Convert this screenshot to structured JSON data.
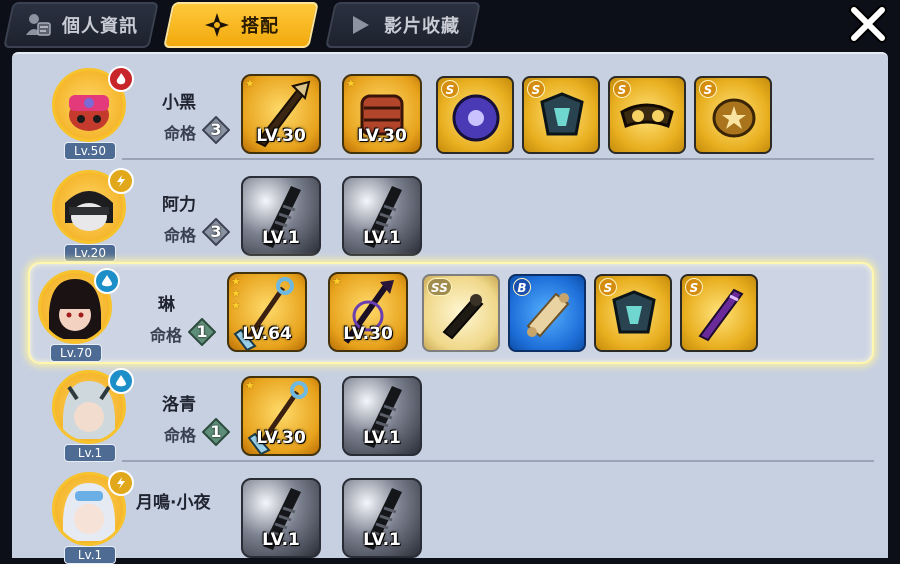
{
  "tabs": [
    {
      "label": "個人資訊",
      "icon": "profile-icon",
      "active": false
    },
    {
      "label": "搭配",
      "icon": "shuriken-icon",
      "active": true
    },
    {
      "label": "影片收藏",
      "icon": "play-icon",
      "active": false
    }
  ],
  "fate_label": "命格",
  "characters": [
    {
      "name": "小黑",
      "level": "Lv.50",
      "element": "fire",
      "fate": "3",
      "weapons": [
        {
          "level": "LV.30",
          "stars": 1,
          "rarity": "gold"
        },
        {
          "level": "LV.30",
          "stars": 1,
          "rarity": "gold"
        }
      ],
      "equipment": [
        {
          "rank": "S"
        },
        {
          "rank": "S"
        },
        {
          "rank": "S"
        },
        {
          "rank": "S"
        }
      ]
    },
    {
      "name": "阿力",
      "level": "Lv.20",
      "element": "thunder",
      "fate": "3",
      "weapons": [
        {
          "level": "LV.1",
          "stars": 0,
          "rarity": "gray"
        },
        {
          "level": "LV.1",
          "stars": 0,
          "rarity": "gray"
        }
      ],
      "equipment": []
    },
    {
      "name": "琳",
      "level": "Lv.70",
      "element": "water",
      "fate": "1",
      "selected": true,
      "weapons": [
        {
          "level": "LV.64",
          "stars": 3,
          "rarity": "gold"
        },
        {
          "level": "LV.30",
          "stars": 1,
          "rarity": "gold"
        }
      ],
      "equipment": [
        {
          "rank": "SS"
        },
        {
          "rank": "B"
        },
        {
          "rank": "S"
        },
        {
          "rank": "S"
        }
      ]
    },
    {
      "name": "洛青",
      "level": "Lv.1",
      "element": "water",
      "fate": "1",
      "weapons": [
        {
          "level": "LV.30",
          "stars": 1,
          "rarity": "gold"
        },
        {
          "level": "LV.1",
          "stars": 0,
          "rarity": "gray"
        }
      ],
      "equipment": []
    },
    {
      "name": "月鳴·小夜",
      "level": "Lv.1",
      "element": "thunder",
      "fate": "",
      "weapons": [
        {
          "level": "LV.1",
          "stars": 0,
          "rarity": "gray"
        },
        {
          "level": "LV.1",
          "stars": 0,
          "rarity": "gray"
        }
      ],
      "equipment": []
    }
  ]
}
